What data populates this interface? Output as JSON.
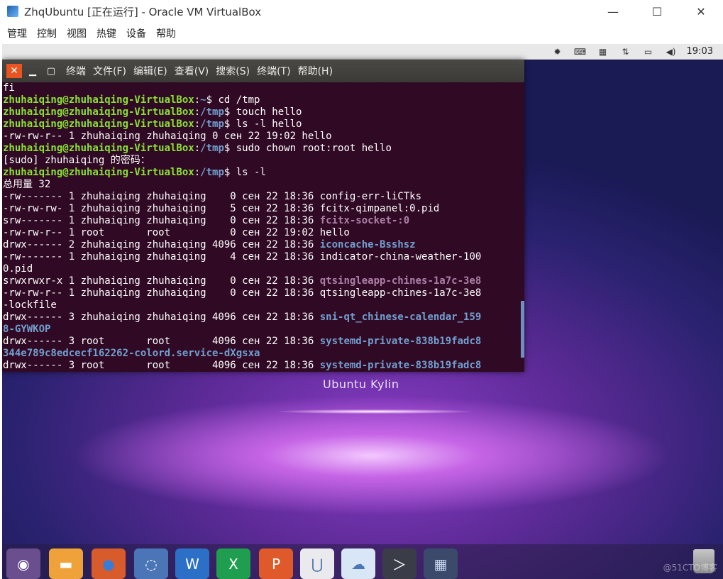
{
  "host": {
    "title": "ZhqUbuntu [正在运行] - Oracle VM VirtualBox",
    "minimize": "—",
    "maximize": "☐",
    "close": "✕",
    "menu": [
      "管理",
      "控制",
      "视图",
      "热键",
      "设备",
      "帮助"
    ]
  },
  "guest_topbar": {
    "clock": "19:03",
    "icons": [
      "settings-icon",
      "keyboard-icon",
      "calendar-icon",
      "network-icon",
      "battery-icon",
      "volume-icon"
    ]
  },
  "desktop": {
    "brand": "Ubuntu Kylin",
    "watermark": "@51CTO博客"
  },
  "terminal": {
    "close": "✕",
    "minimize": "▁",
    "maximize": "▢",
    "title": "终端",
    "menu": [
      "文件(F)",
      "编辑(E)",
      "查看(V)",
      "搜索(S)",
      "终端(T)",
      "帮助(H)"
    ],
    "lines": [
      [
        {
          "t": "fi",
          "c": ""
        }
      ],
      [
        {
          "t": "zhuhaiqing@zhuhaiqing-VirtualBox",
          "c": "p-user"
        },
        {
          "t": ":",
          "c": ""
        },
        {
          "t": "~",
          "c": "p-path"
        },
        {
          "t": "$ cd /tmp",
          "c": ""
        }
      ],
      [
        {
          "t": "zhuhaiqing@zhuhaiqing-VirtualBox",
          "c": "p-user"
        },
        {
          "t": ":",
          "c": ""
        },
        {
          "t": "/tmp",
          "c": "p-path"
        },
        {
          "t": "$ touch hello",
          "c": ""
        }
      ],
      [
        {
          "t": "zhuhaiqing@zhuhaiqing-VirtualBox",
          "c": "p-user"
        },
        {
          "t": ":",
          "c": ""
        },
        {
          "t": "/tmp",
          "c": "p-path"
        },
        {
          "t": "$ ls -l hello",
          "c": ""
        }
      ],
      [
        {
          "t": "-rw-rw-r-- 1 zhuhaiqing zhuhaiqing 0 сен 22 19:02 hello",
          "c": ""
        }
      ],
      [
        {
          "t": "zhuhaiqing@zhuhaiqing-VirtualBox",
          "c": "p-user"
        },
        {
          "t": ":",
          "c": ""
        },
        {
          "t": "/tmp",
          "c": "p-path"
        },
        {
          "t": "$ sudo chown root:root hello",
          "c": ""
        }
      ],
      [
        {
          "t": "[sudo] zhuhaiqing 的密码：",
          "c": ""
        }
      ],
      [
        {
          "t": "zhuhaiqing@zhuhaiqing-VirtualBox",
          "c": "p-user"
        },
        {
          "t": ":",
          "c": ""
        },
        {
          "t": "/tmp",
          "c": "p-path"
        },
        {
          "t": "$ ls -l",
          "c": ""
        }
      ],
      [
        {
          "t": "总用量 32",
          "c": ""
        }
      ],
      [
        {
          "t": "-rw------- 1 zhuhaiqing zhuhaiqing    0 сен 22 18:36 config-err-liCTks",
          "c": ""
        }
      ],
      [
        {
          "t": "-rw-rw-rw- 1 zhuhaiqing zhuhaiqing    5 сен 22 18:36 fcitx-qimpanel:0.pid",
          "c": ""
        }
      ],
      [
        {
          "t": "srw------- 1 zhuhaiqing zhuhaiqing    0 сен 22 18:36 ",
          "c": ""
        },
        {
          "t": "fcitx-socket-:0",
          "c": "f-sock"
        }
      ],
      [
        {
          "t": "-rw-rw-r-- 1 root       root          0 сен 22 19:02 hello",
          "c": ""
        }
      ],
      [
        {
          "t": "drwx------ 2 zhuhaiqing zhuhaiqing 4096 сен 22 18:36 ",
          "c": ""
        },
        {
          "t": "iconcache-Bsshsz",
          "c": "f-dir"
        }
      ],
      [
        {
          "t": "-rw------- 1 zhuhaiqing zhuhaiqing    4 сен 22 18:36 indicator-china-weather-100",
          "c": ""
        }
      ],
      [
        {
          "t": "0.pid",
          "c": ""
        }
      ],
      [
        {
          "t": "srwxrwxr-x 1 zhuhaiqing zhuhaiqing    0 сен 22 18:36 ",
          "c": ""
        },
        {
          "t": "qtsingleapp-chines-1a7c-3e8",
          "c": "f-sock"
        }
      ],
      [
        {
          "t": "-rw-rw-r-- 1 zhuhaiqing zhuhaiqing    0 сен 22 18:36 qtsingleapp-chines-1a7c-3e8",
          "c": ""
        }
      ],
      [
        {
          "t": "-lockfile",
          "c": ""
        }
      ],
      [
        {
          "t": "drwx------ 3 zhuhaiqing zhuhaiqing 4096 сен 22 18:36 ",
          "c": ""
        },
        {
          "t": "sni-qt_chinese-calendar_159",
          "c": "f-dir"
        }
      ],
      [
        {
          "t": "8-GYWKOP",
          "c": "f-dir"
        }
      ],
      [
        {
          "t": "drwx------ 3 root       root       4096 сен 22 18:36 ",
          "c": ""
        },
        {
          "t": "systemd-private-838b19fadc8",
          "c": "f-dir"
        }
      ],
      [
        {
          "t": "344e789c8edcecf162262-colord.service-dXgsxa",
          "c": "f-dir"
        }
      ],
      [
        {
          "t": "drwx------ 3 root       root       4096 сен 22 18:36 ",
          "c": ""
        },
        {
          "t": "systemd-private-838b19fadc8",
          "c": "f-dir"
        }
      ]
    ]
  },
  "dock": {
    "items": [
      {
        "name": "dash-home-icon",
        "glyph": "◉",
        "bg": "#6a4f8f",
        "fg": "#ffffff"
      },
      {
        "name": "files-folder-icon",
        "glyph": "▬",
        "bg": "#f0a23a",
        "fg": "#ffffff"
      },
      {
        "name": "browser-icon",
        "glyph": "●",
        "bg": "#d85b2c",
        "fg": "#3a7bd5"
      },
      {
        "name": "search-tool-icon",
        "glyph": "◌",
        "bg": "#4a76b8",
        "fg": "#ffffff"
      },
      {
        "name": "writer-icon",
        "glyph": "W",
        "bg": "#2b6fc6",
        "fg": "#ffffff"
      },
      {
        "name": "spreadsheet-icon",
        "glyph": "X",
        "bg": "#1f9e4f",
        "fg": "#ffffff"
      },
      {
        "name": "presentation-icon",
        "glyph": "P",
        "bg": "#e0592a",
        "fg": "#ffffff"
      },
      {
        "name": "software-center-icon",
        "glyph": "⋃",
        "bg": "#e9e9ee",
        "fg": "#4a6fa8"
      },
      {
        "name": "cloud-icon",
        "glyph": "☁",
        "bg": "#d9e6f5",
        "fg": "#4a76b8"
      },
      {
        "name": "terminal-icon",
        "glyph": "＞",
        "bg": "#3a3d48",
        "fg": "#ffffff"
      },
      {
        "name": "workspace-switcher-icon",
        "glyph": "▦",
        "bg": "#3b4a6b",
        "fg": "#c6d4ef"
      }
    ]
  }
}
